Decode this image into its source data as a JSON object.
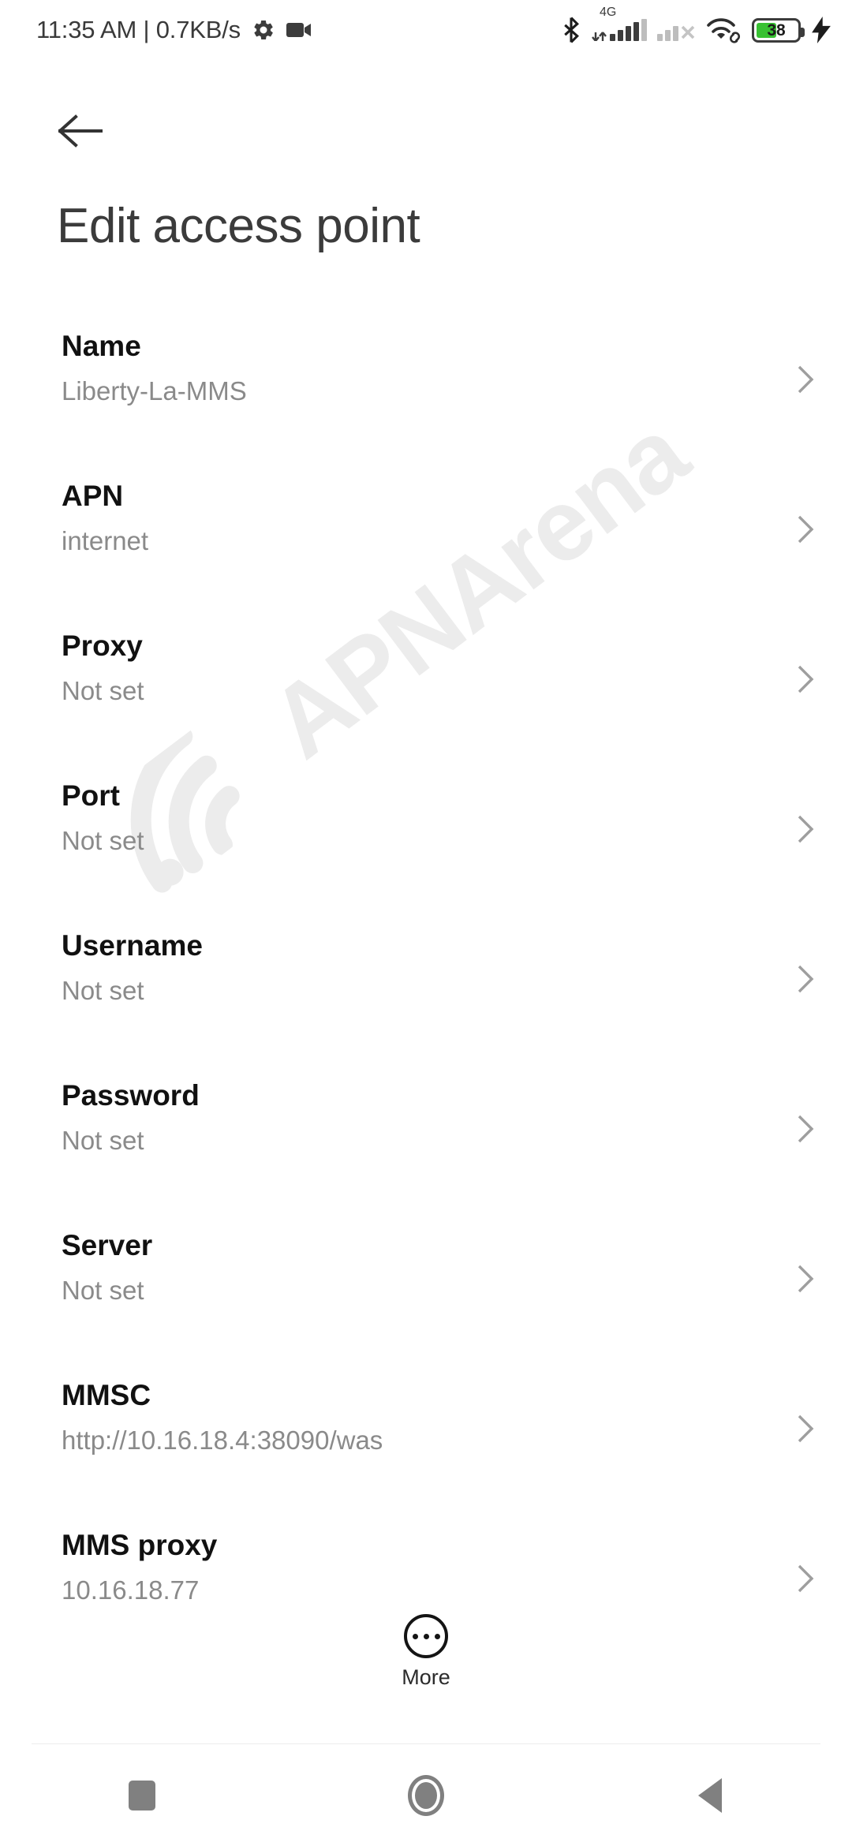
{
  "status_bar": {
    "text": "11:35 AM | 0.7KB/s",
    "battery_level": "38",
    "network_type": "4G",
    "icons": [
      "gear-icon",
      "video-camera-icon",
      "bluetooth-icon",
      "signal-4g-icon",
      "signal-sim2-off-icon",
      "wifi-link-icon",
      "battery-icon",
      "charging-bolt-icon"
    ]
  },
  "header": {
    "back_label": "Back",
    "title": "Edit access point"
  },
  "watermark": {
    "text": "APNArena"
  },
  "settings": {
    "rows": [
      {
        "title": "Name",
        "value": "Liberty-La-MMS"
      },
      {
        "title": "APN",
        "value": "internet"
      },
      {
        "title": "Proxy",
        "value": "Not set"
      },
      {
        "title": "Port",
        "value": "Not set"
      },
      {
        "title": "Username",
        "value": "Not set"
      },
      {
        "title": "Password",
        "value": "Not set"
      },
      {
        "title": "Server",
        "value": "Not set"
      },
      {
        "title": "MMSC",
        "value": "http://10.16.18.4:38090/was"
      },
      {
        "title": "MMS proxy",
        "value": "10.16.18.77"
      }
    ]
  },
  "more_button": {
    "label": "More"
  },
  "nav_bar": {
    "recents_label": "Recents",
    "home_label": "Home",
    "back_label": "Back"
  },
  "colors": {
    "background": "#ffffff",
    "title_text": "#3b3b3b",
    "row_title": "#111111",
    "row_value": "#8a8a8a",
    "chevron": "#9e9e9e",
    "watermark": "#ececec",
    "battery_green": "#38c132",
    "nav_icon": "#808080"
  }
}
